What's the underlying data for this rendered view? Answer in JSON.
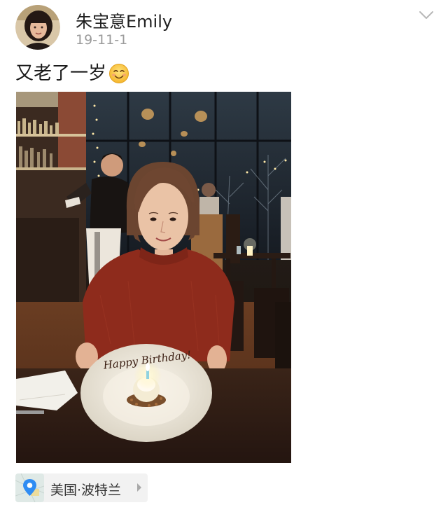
{
  "post": {
    "username": "朱宝意Emily",
    "date": "19-11-1",
    "text": "又老了一岁",
    "emoji": "smile-emoji"
  },
  "photo": {
    "cake_message": "Happy Birthday!"
  },
  "location": {
    "label": "美国·波特兰",
    "icon": "map-pin-icon"
  },
  "icons": {
    "more": "chevron-down-icon",
    "location_arrow": "chevron-right-icon"
  },
  "colors": {
    "date_gray": "#9a9a9a",
    "location_pin": "#2f8cf3",
    "chip_background": "#f2f2f2",
    "sweater": "#8e2b1c"
  }
}
